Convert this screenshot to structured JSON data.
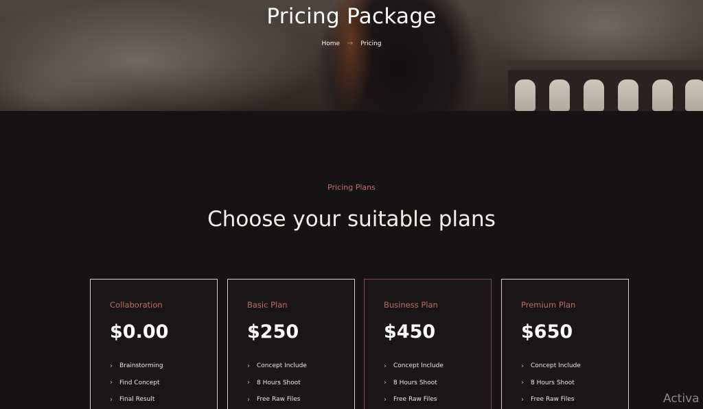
{
  "hero": {
    "title": "Pricing Package",
    "breadcrumb": {
      "home": "Home",
      "separator": "→",
      "current": "Pricing"
    }
  },
  "section": {
    "eyebrow": "Pricing Plans",
    "title": "Choose your suitable plans"
  },
  "plans": [
    {
      "name": "Collaboration",
      "price": "$0.00",
      "features": [
        "Brainstorming",
        "Find Concept",
        "Final Result"
      ]
    },
    {
      "name": "Basic Plan",
      "price": "$250",
      "features": [
        "Concept Include",
        "8 Hours Shoot",
        "Free Raw Files"
      ]
    },
    {
      "name": "Business Plan",
      "price": "$450",
      "features": [
        "Concept Include",
        "8 Hours Shoot",
        "Free Raw Files"
      ]
    },
    {
      "name": "Premium Plan",
      "price": "$650",
      "features": [
        "Concept Include",
        "8 Hours Shoot",
        "Free Raw Files"
      ]
    }
  ],
  "icons": {
    "feature_bullet": "chevron-right-icon",
    "breadcrumb_separator": "arrow-right-icon"
  },
  "colors": {
    "accent": "#c06e62",
    "background": "#161314",
    "card_border": "#d6d0c8"
  },
  "watermark": "Activa"
}
